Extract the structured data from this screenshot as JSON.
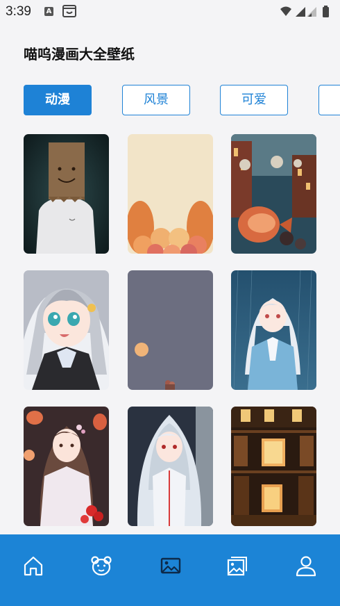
{
  "status": {
    "time": "3:39",
    "notification_letter": "A"
  },
  "app": {
    "title": "喵呜漫画大全壁纸"
  },
  "tabs": [
    {
      "label": "动漫",
      "active": true
    },
    {
      "label": "风景",
      "active": false
    },
    {
      "label": "可爱",
      "active": false
    }
  ],
  "wallpapers": [
    {
      "subject": "paper-bag-boy"
    },
    {
      "subject": "cute-eggs"
    },
    {
      "subject": "koi-fish-town"
    },
    {
      "subject": "silver-hair-girl"
    },
    {
      "subject": "gray-minimal"
    },
    {
      "subject": "white-hair-rain-girl"
    },
    {
      "subject": "hanfu-girl-lanterns"
    },
    {
      "subject": "hooded-girl"
    },
    {
      "subject": "library-interior"
    }
  ],
  "bottom_nav": [
    {
      "icon": "home-icon"
    },
    {
      "icon": "bear-icon"
    },
    {
      "icon": "image-icon",
      "active": true
    },
    {
      "icon": "gallery-icon"
    },
    {
      "icon": "profile-icon"
    }
  ],
  "colors": {
    "accent": "#1e82d6",
    "nav_background": "#1c84d6",
    "background": "#f4f4f6"
  }
}
